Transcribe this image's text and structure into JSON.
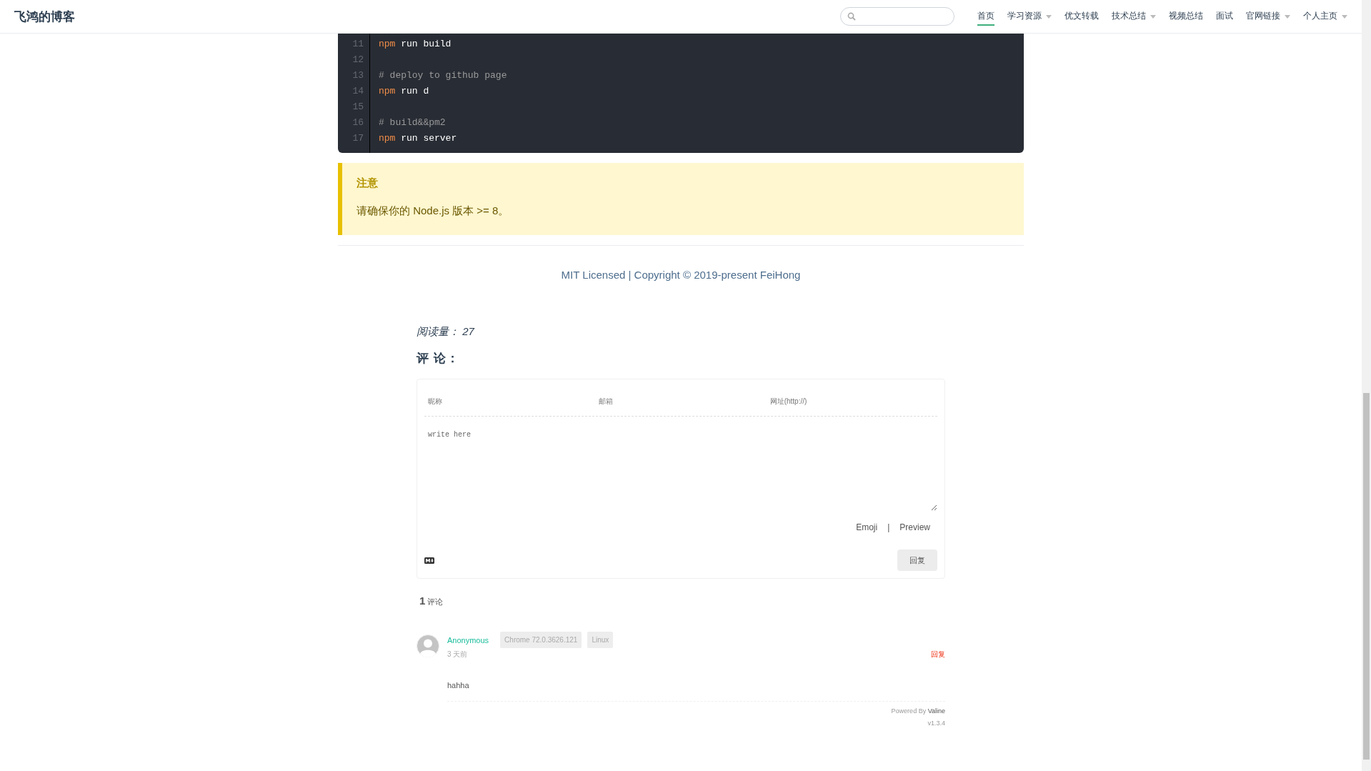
{
  "site_title": "飞鸿的博客",
  "nav": [
    {
      "label": "首页",
      "selected": true,
      "dropdown": false
    },
    {
      "label": "学习资源",
      "selected": false,
      "dropdown": true
    },
    {
      "label": "优文转载",
      "selected": false,
      "dropdown": false
    },
    {
      "label": "技术总结",
      "selected": false,
      "dropdown": true
    },
    {
      "label": "视频总结",
      "selected": false,
      "dropdown": false
    },
    {
      "label": "面试",
      "selected": false,
      "dropdown": false
    },
    {
      "label": "官网链接",
      "selected": false,
      "dropdown": true
    },
    {
      "label": "个人主页",
      "selected": false,
      "dropdown": true
    }
  ],
  "code_lines": [
    {
      "number": "11",
      "tokens": [
        {
          "kind": "command",
          "text": "npm"
        },
        {
          "kind": "plain",
          "text": " run build"
        }
      ]
    },
    {
      "number": "12"
    },
    {
      "number": "13",
      "tokens": [
        {
          "kind": "comment",
          "text": "# deploy to github page"
        }
      ]
    },
    {
      "number": "14",
      "tokens": [
        {
          "kind": "command",
          "text": "npm"
        },
        {
          "kind": "plain",
          "text": " run d"
        }
      ]
    },
    {
      "number": "15"
    },
    {
      "number": "16",
      "tokens": [
        {
          "kind": "comment",
          "text": "# build&&pm2"
        }
      ]
    },
    {
      "number": "17",
      "tokens": [
        {
          "kind": "command",
          "text": "npm"
        },
        {
          "kind": "plain",
          "text": " run server"
        }
      ]
    }
  ],
  "tip": {
    "title": "注意",
    "text": "请确保你的 Node.js 版本 >= 8。"
  },
  "footer": "MIT Licensed | Copyright © 2019-present FeiHong",
  "read_count": "阅读量： 27",
  "comments_heading": "评 论：",
  "form": {
    "fields": [
      {
        "placeholder": "昵称"
      },
      {
        "placeholder": "邮箱"
      },
      {
        "placeholder": "网址(http://)"
      }
    ],
    "textarea_placeholder": "write here",
    "emoji": "Emoji",
    "separator": "|",
    "preview": "Preview",
    "submit": "回复"
  },
  "comment_count": {
    "number": "1",
    "label": "评论"
  },
  "comments": [
    {
      "author": "Anonymous",
      "browser": "Chrome 72.0.3626.121",
      "os": "Linux",
      "time": "3 天前",
      "reply": "回复",
      "text": "hahha"
    }
  ],
  "powered": {
    "prefix": "Powered By ",
    "name": "Valine",
    "version": "v1.3.4"
  }
}
